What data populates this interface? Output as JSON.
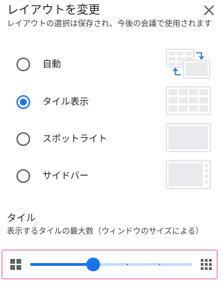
{
  "dialog": {
    "title": "レイアウトを変更",
    "subtitle": "レイアウトの選択は保存され、今後の会議で使用されます",
    "close_icon": "close-icon"
  },
  "layouts": [
    {
      "label": "自動",
      "checked": false,
      "thumbnail": "auto-layout-icon"
    },
    {
      "label": "タイル表示",
      "checked": true,
      "thumbnail": "tiled-layout-icon"
    },
    {
      "label": "スポットライト",
      "checked": false,
      "thumbnail": "spotlight-layout-icon"
    },
    {
      "label": "サイドバー",
      "checked": false,
      "thumbnail": "sidebar-layout-icon"
    }
  ],
  "tiles": {
    "title": "タイル",
    "description": "表示するタイルの最大数（ウィンドウのサイズによる）",
    "slider_fraction": 0.39,
    "small_icon": "small-grid-icon",
    "large_icon": "large-grid-icon"
  },
  "colors": {
    "accent": "#1a73e8",
    "track": "#c6dafc",
    "highlight_border": "#f2a7c7"
  }
}
